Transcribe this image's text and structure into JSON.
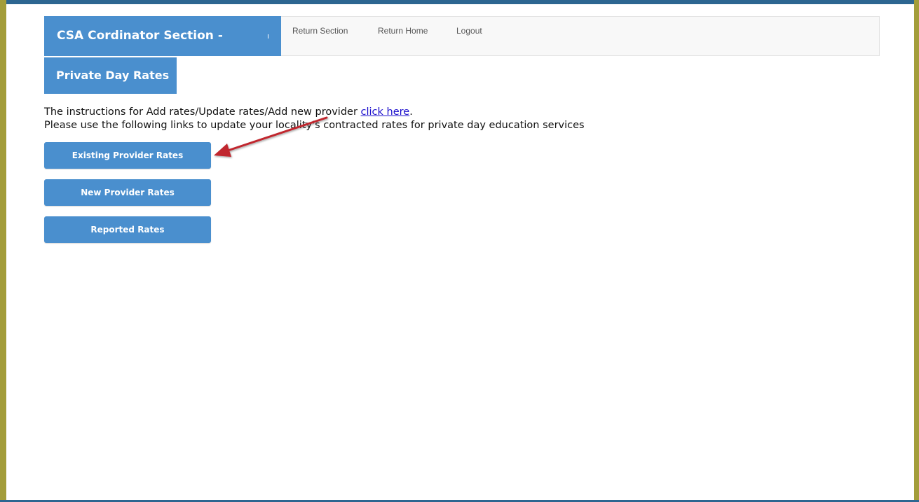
{
  "header": {
    "brand_title": "CSA Cordinator Section -",
    "brand_tick": "ı",
    "nav": [
      {
        "label": "Return Section"
      },
      {
        "label": "Return Home"
      },
      {
        "label": "Logout"
      }
    ]
  },
  "page": {
    "subtitle": "Private Day Rates",
    "instructions_prefix": "The instructions for Add rates/Update rates/Add new provider ",
    "instructions_link": "click here",
    "instructions_suffix": ".",
    "instructions_line2": "Please use the following links to update your locality's contracted rates for private day education services"
  },
  "buttons": {
    "existing": "Existing Provider Rates",
    "new": "New Provider Rates",
    "reported": "Reported Rates"
  },
  "colors": {
    "primary": "#4a8fce",
    "frame_side": "#a39d3a",
    "frame_top": "#2d6691",
    "annotation_arrow": "#c0272d",
    "link": "#1a0dcc"
  }
}
